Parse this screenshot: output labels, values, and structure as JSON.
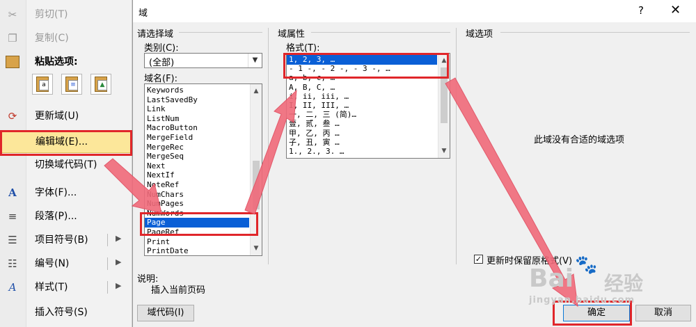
{
  "context_menu": {
    "items": [
      {
        "label": "剪切(T)",
        "icon": "scissors-icon",
        "glyph": "✂",
        "disabled": true
      },
      {
        "label": "复制(C)",
        "icon": "copy-icon",
        "glyph": "❐",
        "disabled": true
      },
      {
        "label": "粘贴选项:",
        "icon": "paste-icon",
        "glyph": "📋",
        "disabled": false
      },
      {
        "label": "更新域(U)",
        "icon": "update-field-icon",
        "glyph": "⟳",
        "disabled": false
      },
      {
        "label": "编辑域(E)...",
        "icon": "edit-field-icon",
        "glyph": "",
        "disabled": false
      },
      {
        "label": "切换域代码(T)",
        "icon": "toggle-field-code-icon",
        "glyph": "",
        "disabled": false
      },
      {
        "label": "字体(F)...",
        "icon": "font-icon",
        "glyph": "A",
        "disabled": false
      },
      {
        "label": "段落(P)...",
        "icon": "paragraph-icon",
        "glyph": "≡",
        "disabled": false
      },
      {
        "label": "项目符号(B)",
        "icon": "bullets-icon",
        "glyph": "☰",
        "disabled": false
      },
      {
        "label": "编号(N)",
        "icon": "numbering-icon",
        "glyph": "☷",
        "disabled": false
      },
      {
        "label": "样式(T)",
        "icon": "styles-icon",
        "glyph": "A",
        "disabled": false
      },
      {
        "label": "插入符号(S)",
        "icon": "insert-symbol-icon",
        "glyph": "",
        "disabled": false
      }
    ],
    "paste_icons": [
      "a",
      "≡",
      "▲"
    ]
  },
  "dialog": {
    "title": "域",
    "help": "?",
    "close": "✕",
    "choose_field": {
      "group_label": "请选择域",
      "category_label": "类别(C):",
      "category_value": "(全部)",
      "field_names_label": "域名(F):",
      "field_names": [
        "Keywords",
        "LastSavedBy",
        "Link",
        "ListNum",
        "MacroButton",
        "MergeField",
        "MergeRec",
        "MergeSeq",
        "Next",
        "NextIf",
        "NoteRef",
        "NumChars",
        "NumPages",
        "NumWords",
        "Page",
        "PageRef",
        "Print",
        "PrintDate"
      ],
      "selected": "Page"
    },
    "field_properties": {
      "group_label": "域属性",
      "format_label": "格式(T):",
      "formats": [
        "1, 2, 3, …",
        "- 1 -, - 2 -, - 3 -, …",
        "a, b, c, …",
        "A, B, C, …",
        "i, ii, iii, …",
        "I, II, III, …",
        "一, 二, 三 (简)…",
        "壹, 贰, 叁 …",
        "甲, 乙, 丙 …",
        "子, 丑, 寅 …",
        "1., 2., 3. …"
      ],
      "selected": "1, 2, 3, …"
    },
    "field_options": {
      "group_label": "域选项",
      "no_options_text": "此域没有合适的域选项",
      "preserve_format_label": "更新时保留原格式(V)",
      "preserve_format_checked": "✓"
    },
    "description": {
      "label": "说明:",
      "text": "插入当前页码"
    },
    "buttons": {
      "field_codes": "域代码(I)",
      "ok": "确定",
      "cancel": "取消"
    }
  },
  "watermark": {
    "brand": "Bai",
    "brand2": "经验",
    "url": "jingyan.baidu.com"
  },
  "colors": {
    "highlight_box": "#e0262a",
    "arrow": "#f06a7a",
    "selection": "#0a5fd6",
    "menu_highlight": "#fce79a"
  }
}
